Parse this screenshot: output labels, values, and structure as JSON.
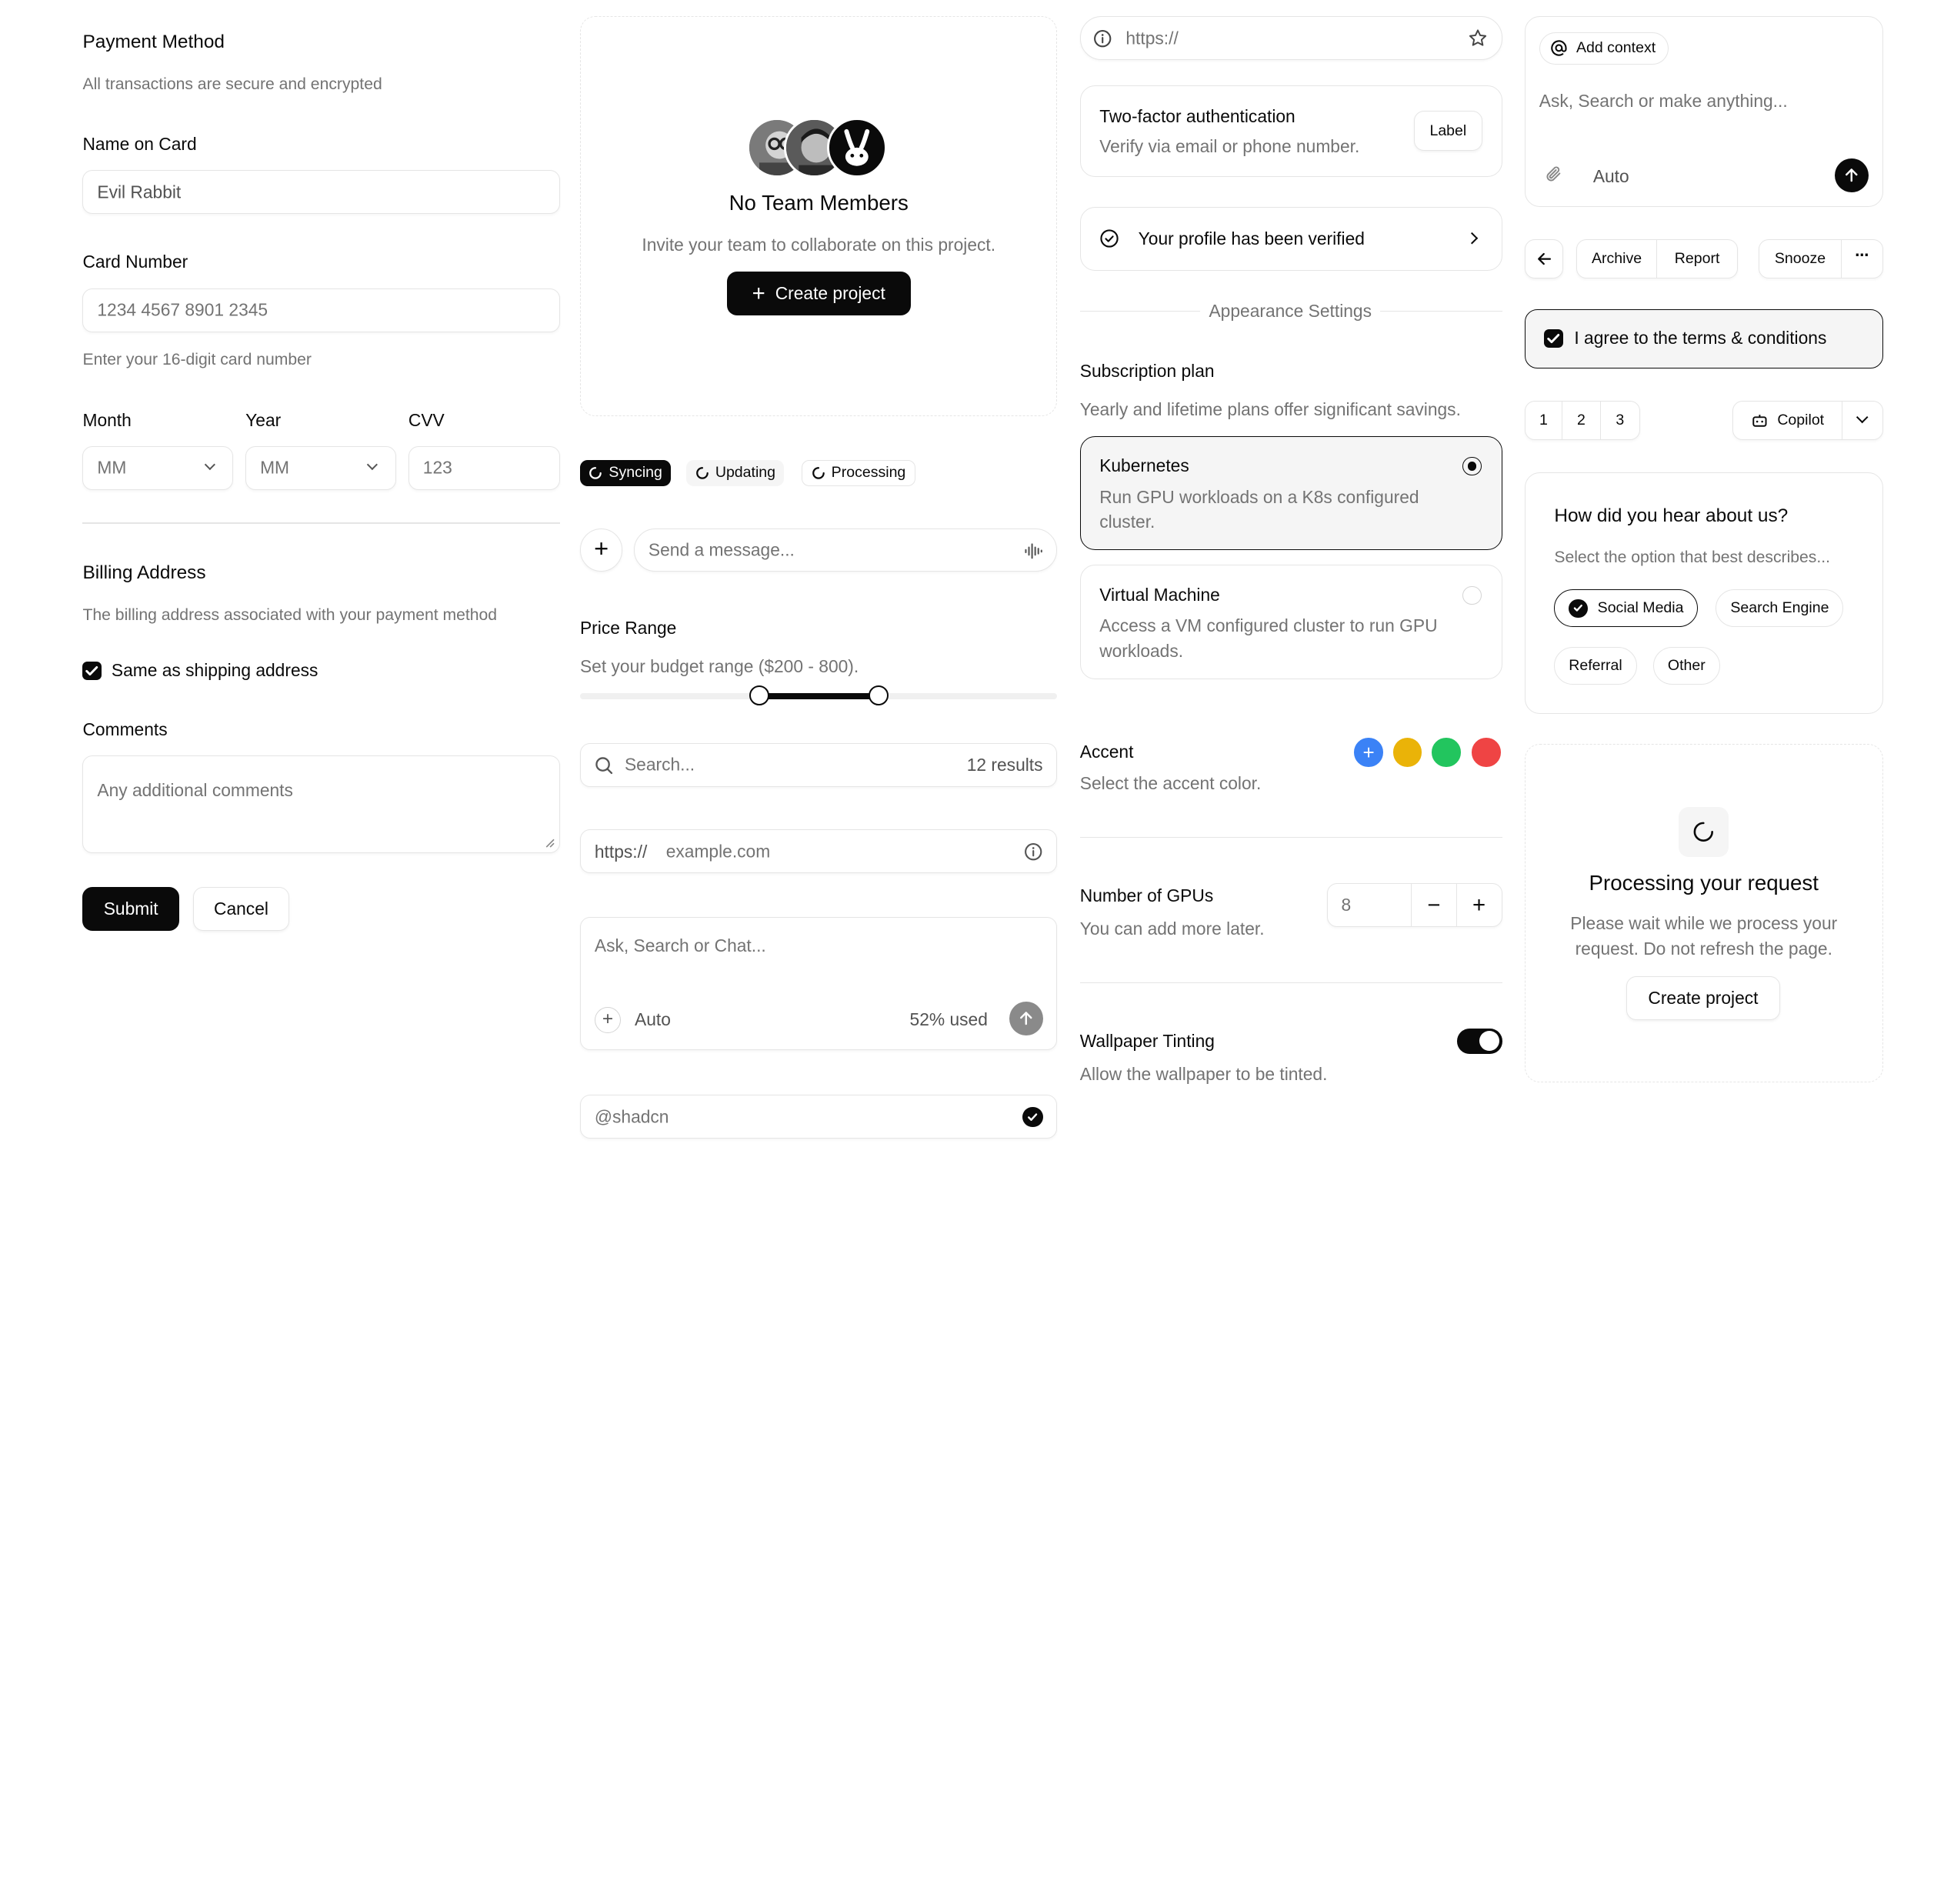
{
  "payment": {
    "title": "Payment Method",
    "subtitle": "All transactions are secure and encrypted",
    "name_label": "Name on Card",
    "name_value": "Evil Rabbit",
    "card_label": "Card Number",
    "card_placeholder": "1234 4567 8901 2345",
    "card_hint": "Enter your 16-digit card number",
    "month_label": "Month",
    "month_placeholder": "MM",
    "year_label": "Year",
    "year_placeholder": "MM",
    "cvv_label": "CVV",
    "cvv_placeholder": "123",
    "billing_title": "Billing Address",
    "billing_subtitle": "The billing address associated with your payment method",
    "same_as_shipping": "Same as shipping address",
    "same_as_shipping_checked": true,
    "comments_label": "Comments",
    "comments_placeholder": "Any additional comments",
    "submit": "Submit",
    "cancel": "Cancel"
  },
  "team": {
    "title": "No Team Members",
    "description": "Invite your team to collaborate on this project.",
    "create_button": "Create project"
  },
  "status_badges": [
    {
      "label": "Syncing",
      "active": true
    },
    {
      "label": "Updating",
      "active": false
    },
    {
      "label": "Processing",
      "active": false
    }
  ],
  "message": {
    "placeholder": "Send a message..."
  },
  "price": {
    "label": "Price Range",
    "description": "Set your budget range ($200 - 800).",
    "min": 200,
    "max": 800,
    "range_start_fraction": 0.375,
    "range_end_fraction": 0.625
  },
  "search": {
    "placeholder": "Search...",
    "results": "12 results"
  },
  "url": {
    "prefix": "https://",
    "placeholder": "example.com"
  },
  "chat": {
    "placeholder": "Ask, Search or Chat...",
    "mode": "Auto",
    "usage": "52% used"
  },
  "username": {
    "value": "@shadcn"
  },
  "browser_bar": {
    "placeholder": "https://"
  },
  "two_factor": {
    "title": "Two-factor authentication",
    "description": "Verify via email or phone number.",
    "button": "Label"
  },
  "verified": {
    "text": "Your profile has been verified"
  },
  "appearance": {
    "label": "Appearance Settings"
  },
  "subscription": {
    "title": "Subscription plan",
    "description": "Yearly and lifetime plans offer significant savings.",
    "options": [
      {
        "title": "Kubernetes",
        "description": "Run GPU workloads on a K8s configured cluster.",
        "selected": true
      },
      {
        "title": "Virtual Machine",
        "description": "Access a VM configured cluster to run GPU workloads.",
        "selected": false
      }
    ]
  },
  "accent": {
    "title": "Accent",
    "description": "Select the accent color.",
    "colors": [
      "#3b82f6",
      "#eab308",
      "#22c55e",
      "#ef4444"
    ],
    "selected_index": 0
  },
  "gpus": {
    "title": "Number of GPUs",
    "description": "You can add more later.",
    "value": "8"
  },
  "wallpaper": {
    "title": "Wallpaper Tinting",
    "description": "Allow the wallpaper to be tinted.",
    "enabled": true
  },
  "prompt": {
    "add_context": "Add context",
    "placeholder": "Ask, Search or make anything...",
    "mode": "Auto"
  },
  "mail_toolbar": {
    "archive": "Archive",
    "report": "Report",
    "snooze": "Snooze"
  },
  "terms": {
    "label": "I agree to the terms & conditions",
    "checked": true
  },
  "pagination": {
    "pages": [
      "1",
      "2",
      "3"
    ]
  },
  "copilot": {
    "label": "Copilot"
  },
  "survey": {
    "title": "How did you hear about us?",
    "description": "Select the option that best describes...",
    "options": [
      {
        "label": "Social Media",
        "selected": true
      },
      {
        "label": "Search Engine",
        "selected": false
      },
      {
        "label": "Referral",
        "selected": false
      },
      {
        "label": "Other",
        "selected": false
      }
    ]
  },
  "processing": {
    "title": "Processing your request",
    "description_line1": "Please wait while we process your",
    "description_line2": "request. Do not refresh the page.",
    "button": "Create project"
  }
}
